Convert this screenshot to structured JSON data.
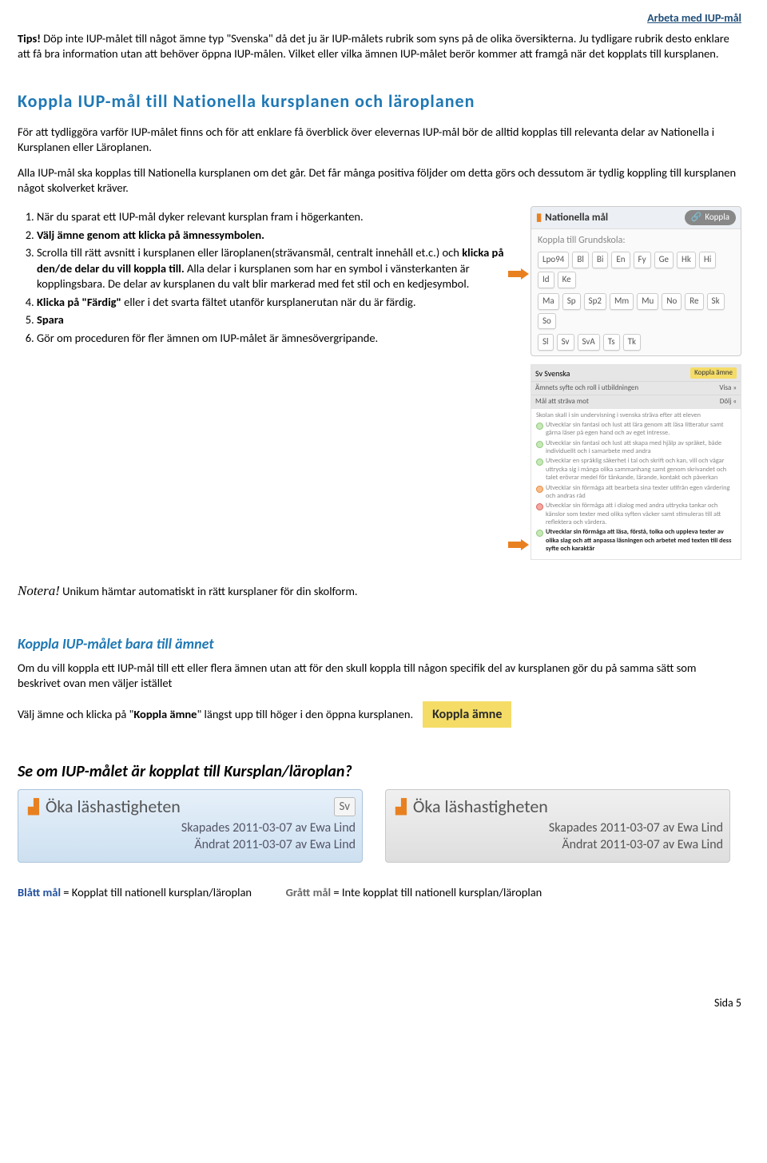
{
  "header": {
    "right": "Arbeta med IUP-mål"
  },
  "tips": {
    "label": "Tips!",
    "text": " Döp inte IUP-målet till något ämne typ \"Svenska\" då det ju är IUP-målets rubrik som syns på de olika översikterna. Ju tydligare rubrik desto enklare att få bra information utan att behöver öppna IUP-målen. Vilket eller vilka ämnen IUP-målet berör kommer att framgå när det kopplats till kursplanen."
  },
  "h2a": "Koppla IUP-mål till Nationella kursplanen och läroplanen",
  "para1": "För att tydliggöra varför IUP-målet finns och för att enklare få överblick över elevernas IUP-mål bör de alltid kopplas till relevanta delar av Nationella i Kursplanen eller Läroplanen.",
  "para2": "Alla IUP-mål ska kopplas till Nationella kursplanen om det går. Det får många positiva följder om detta görs och dessutom är tydlig koppling till kursplanen något skolverket kräver.",
  "steps": {
    "s1": "När du sparat ett IUP-mål dyker relevant kursplan fram i högerkanten.",
    "s2": "Välj ämne genom att klicka på ämnessymbolen.",
    "s3a": "Scrolla till rätt avsnitt i kursplanen eller läroplanen(strävansmål, centralt innehåll et.c.) och ",
    "s3b": "klicka på den/de delar du vill koppla till.",
    "s3c": " Alla delar i kursplanen som har en symbol i vänsterkanten är kopplingsbara. De delar av kursplanen du valt blir  markerad med fet stil och en kedjesymbol.",
    "s4a": "Klicka på \"Färdig\"",
    "s4b": " eller i det svarta fältet utanför kursplanerutan när du är färdig.",
    "s5": "Spara",
    "s6": "Gör om proceduren för fler ämnen om IUP-målet är ämnesövergripande."
  },
  "notera": {
    "label": "Notera!",
    "text": " Unikum hämtar automatiskt in rätt kursplaner för din skolform."
  },
  "h3b": "Koppla IUP-målet bara till ämnet",
  "para3": "Om du vill koppla ett IUP-mål till ett eller flera ämnen utan att för den skull koppla till någon specifik del av kursplanen gör du på samma sätt som beskrivet ovan men väljer istället",
  "para4a": "Välj ämne och klicka på \"",
  "para4b": "Koppla ämne",
  "para4c": "\" längst upp till höger i den öppna kursplanen.",
  "koppla_amne_btn": "Koppla ämne",
  "h3c": "Se om IUP-målet är kopplat till Kursplan/läroplan?",
  "nationella": {
    "title": "Nationella mål",
    "koppla": "Koppla",
    "subtitle": "Koppla till Grundskola:",
    "chips1": [
      "Lpo94",
      "Bl",
      "Bi",
      "En",
      "Fy",
      "Ge",
      "Hk",
      "Hi",
      "Id",
      "Ke"
    ],
    "chips2": [
      "Ma",
      "Sp",
      "Sp2",
      "Mm",
      "Mu",
      "No",
      "Re",
      "Sk",
      "So"
    ],
    "chips3": [
      "Sl",
      "Sv",
      "SvA",
      "Ts",
      "Tk"
    ]
  },
  "kp": {
    "head_left": "Sv  Svenska",
    "head_btn": "Koppla ämne",
    "row1_l": "Ämnets syfte och roll i utbildningen",
    "row1_r": "Visa »",
    "row2_l": "Mål att sträva mot",
    "row2_r": "Dölj «",
    "intro": "Skolan skall i sin undervisning i svenska sträva efter att eleven",
    "l1": "Utvecklar sin fantasi och lust att lära genom att läsa litteratur samt gärna läser på egen hand och av eget intresse.",
    "l2": "Utvecklar sin fantasi och lust att skapa med hjälp av språket, både individuellt och i samarbete med andra",
    "l3": "Utvecklar en språklig säkerhet i tal och skrift och kan, vill och vågar uttrycka sig i många olika sammanhang samt genom skrivandet och talet erövrar medel för tänkande, lärande, kontakt och påverkan",
    "l4": "Utvecklar sin förmåga att bearbeta sina texter utifrån egen värdering och andras råd",
    "l5": "Utvecklar sin förmåga att i dialog med andra uttrycka tankar och känslor som texter med olika syften väcker samt stimuleras till att reflektera och värdera.",
    "l6": "Utvecklar sin förmåga att läsa, förstå, tolka och uppleva texter av olika slag och att anpassa läsningen och arbetet med texten till dess syfte och karaktär"
  },
  "cards": {
    "blue": {
      "title": "Öka läshastigheten",
      "sv": "Sv",
      "m1": "Skapades 2011-03-07 av Ewa Lind",
      "m2": "Ändrat 2011-03-07 av Ewa Lind"
    },
    "gray": {
      "title": "Öka läshastigheten",
      "m1": "Skapades 2011-03-07 av Ewa Lind",
      "m2": "Ändrat 2011-03-07 av Ewa Lind"
    }
  },
  "legend": {
    "blue_l": "Blått mål",
    "blue_t": " = Kopplat till nationell kursplan/läroplan",
    "gray_l": "Grått mål",
    "gray_t": " = Inte kopplat till nationell kursplan/läroplan"
  },
  "footer": "Sida 5"
}
